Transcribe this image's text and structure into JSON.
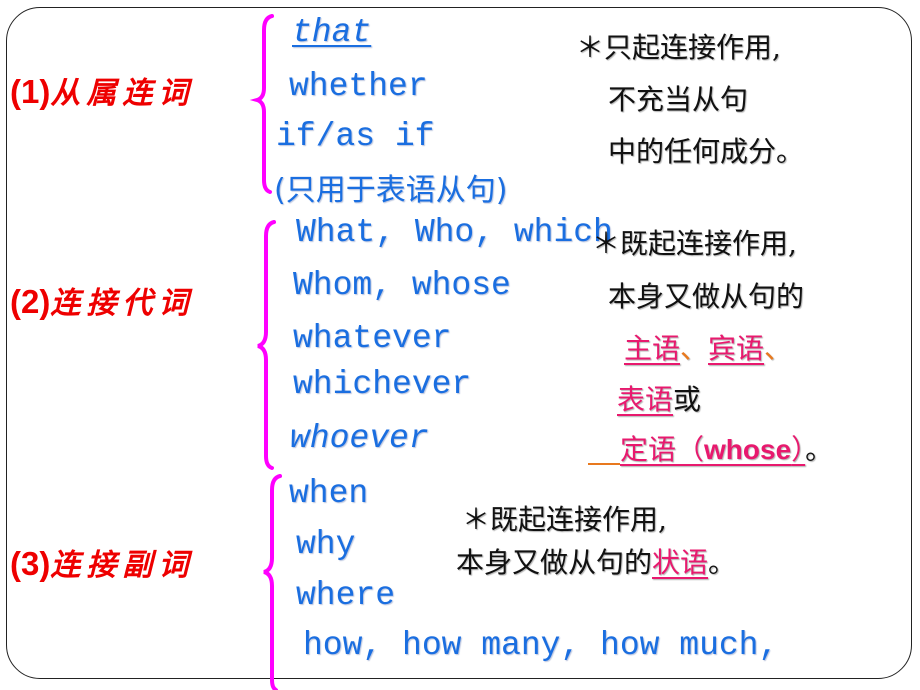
{
  "sections": [
    {
      "heading_num": "(1)",
      "heading_cn": "从属连词",
      "words": [
        "that",
        "whether",
        "if/as if",
        "(只用于表语从句)"
      ],
      "note_lines": [
        "＊只起连接作用,",
        "不充当从句",
        "中的任何成分。"
      ]
    },
    {
      "heading_num": "(2)",
      "heading_cn": "连接代词",
      "words": [
        "What, Who, which",
        "Whom, whose",
        "whatever",
        "whichever",
        "whoever"
      ],
      "note_lines": [
        "＊既起连接作用,",
        "本身又做从句的"
      ],
      "roles": {
        "subject": "主语",
        "sep1": "、",
        "object": "宾语",
        "sep2": "、",
        "predicative": "表语",
        "or": "或",
        "attributive": "定语（",
        "attributive_en": "whose",
        "attributive_close": "）",
        "period": "。"
      }
    },
    {
      "heading_num": "(3)",
      "heading_cn": "连接副词",
      "words": [
        "when",
        "why",
        "where",
        "how, how many, how much,"
      ],
      "note_lines": [
        "＊既起连接作用,",
        "本身又做从句的"
      ],
      "adverbial": "状语",
      "period": "。"
    }
  ],
  "colors": {
    "heading": "#ee0000",
    "word": "#1a6ee0",
    "brace": "#ff00ff",
    "role": "#e8196e",
    "separator": "#e8791e"
  }
}
